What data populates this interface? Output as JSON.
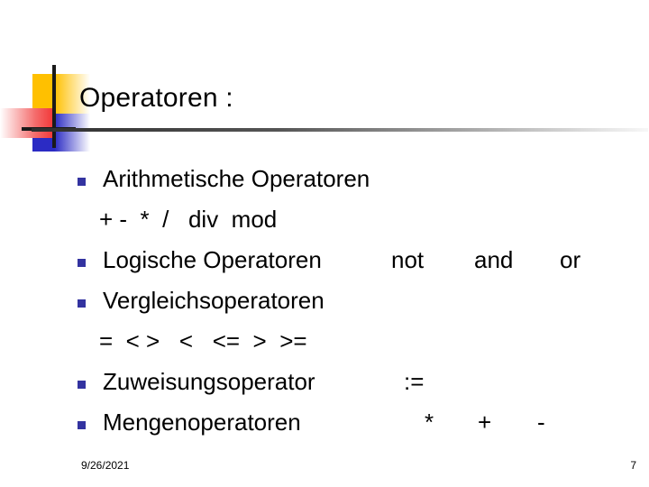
{
  "slide": {
    "title": "Operatoren :",
    "accent_yellow": "#FFC000",
    "accent_blue": "#2B2BC4",
    "accent_red": "#F23030",
    "bullet_color": "#3333A0"
  },
  "bullets": [
    {
      "label": "Arithmetische Operatoren",
      "inline_ops": "",
      "sub": "+ -  *  /   div  mod"
    },
    {
      "label": "Logische Operatoren",
      "op_not": "not",
      "op_and": "and",
      "op_or": "or",
      "sub": ""
    },
    {
      "label": "Vergleichsoperatoren",
      "inline_ops": "",
      "sub": "=  < >   <   <=  >  >="
    },
    {
      "label": "Zuweisungsoperator",
      "inline_ops": ":=",
      "sub": ""
    },
    {
      "label": "Mengenoperatoren",
      "op_star": "*",
      "op_plus": "+",
      "op_minus": "-",
      "sub": ""
    }
  ],
  "footer": {
    "date": "9/26/2021",
    "page_number": "7"
  }
}
